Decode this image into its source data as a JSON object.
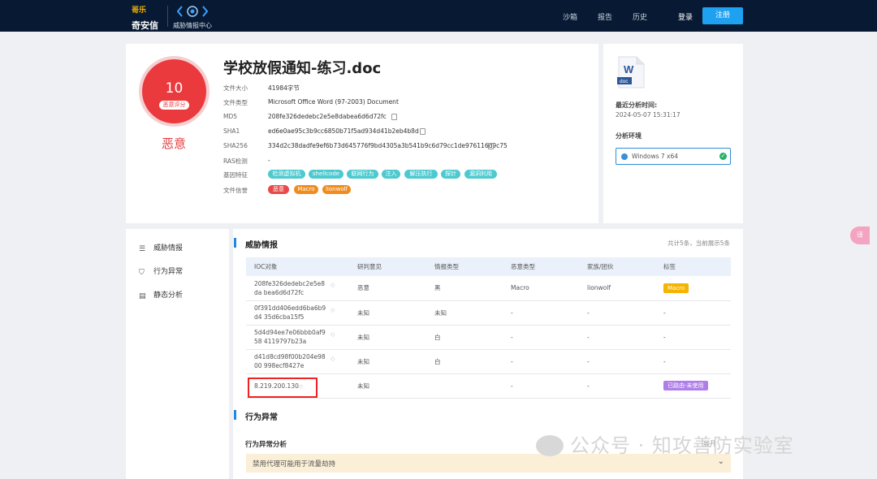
{
  "header": {
    "brand_mark": "哥乐",
    "brand_name": "奇安信",
    "ti_label": "威胁情报中心",
    "nav": [
      "沙箱",
      "报告",
      "历史"
    ],
    "login": "登录",
    "register": "注册"
  },
  "summary": {
    "score": "10",
    "score_badge": "恶意评分",
    "verdict": "恶意",
    "title": "学校放假通知-练习.doc",
    "attributes": [
      {
        "label": "文件大小",
        "value": "41984字节"
      },
      {
        "label": "文件类型",
        "value": "Microsoft Office Word (97-2003) Document"
      },
      {
        "label": "MD5",
        "value": "208fe326dedebc2e5e8dabea6d6d72fc"
      },
      {
        "label": "SHA1",
        "value": "ed6e0ae95c3b9cc6850b71f5ad934d41b2eb4b8d"
      },
      {
        "label": "SHA256",
        "value": "334d2c38dadfe9ef6b73d645776f9bd4305a3b541b9c6d79cc1de976116d9c75"
      },
      {
        "label": "RAS检测",
        "value": "-"
      },
      {
        "label": "基因特征",
        "value": ""
      },
      {
        "label": "文件信誉",
        "value": ""
      }
    ],
    "gene_tags": [
      "检测虚拟机",
      "shellcode",
      "联网行为",
      "注入",
      "解压执行",
      "探针",
      "漏洞利用"
    ],
    "reputation_tags": [
      "恶意",
      "Macro",
      "lionwolf"
    ]
  },
  "analysis": {
    "doc_icon_letter": "W",
    "doc_icon_ext": "doc",
    "last_time_label": "最近分析时间:",
    "last_time": "2024-05-07 15:31:17",
    "env_label": "分析环境",
    "env_value": "Windows 7 x64",
    "colors": {
      "accent": "#1e88e5",
      "malicious": "#ea3a3e"
    }
  },
  "sidebar": {
    "items": [
      {
        "label": "威胁情报",
        "icon": "document-list-icon"
      },
      {
        "label": "行为异常",
        "icon": "shield-icon"
      },
      {
        "label": "静态分析",
        "icon": "static-analysis-icon"
      }
    ]
  },
  "threat_intel": {
    "title": "威胁情报",
    "count": "共计5条，当前展示5条",
    "columns": [
      "IOC对象",
      "研判意见",
      "情报类型",
      "恶意类型",
      "家族/团伙",
      "标签"
    ],
    "rows": [
      {
        "ioc": "208fe326dedebc2e5e8da bea6d6d72fc",
        "opinion": "恶意",
        "type": "黑",
        "mal_type": "Macro",
        "family": "lionwolf",
        "tag": "Macro"
      },
      {
        "ioc": "0f391dd406edd6ba6b9d4 35d6cba15f5",
        "opinion": "未知",
        "type": "未知",
        "mal_type": "-",
        "family": "-",
        "tag": "-"
      },
      {
        "ioc": "5d4d94ee7e06bbb0af958 4119797b23a",
        "opinion": "未知",
        "type": "白",
        "mal_type": "-",
        "family": "-",
        "tag": "-"
      },
      {
        "ioc": "d41d8cd98f00b204e9800 998ecf8427e",
        "opinion": "未知",
        "type": "白",
        "mal_type": "-",
        "family": "-",
        "tag": "-"
      },
      {
        "ioc": "8.219.200.130",
        "opinion": "未知",
        "type": "",
        "mal_type": "-",
        "family": "-",
        "tag": "已路由-未使用"
      }
    ]
  },
  "behavior": {
    "title": "行为异常",
    "subtitle": "行为异常分析",
    "expand_label": "展开",
    "item": "禁用代理可能用于流量劫持"
  },
  "watermark": "公众号 · 知攻善防实验室",
  "float_button": "译"
}
